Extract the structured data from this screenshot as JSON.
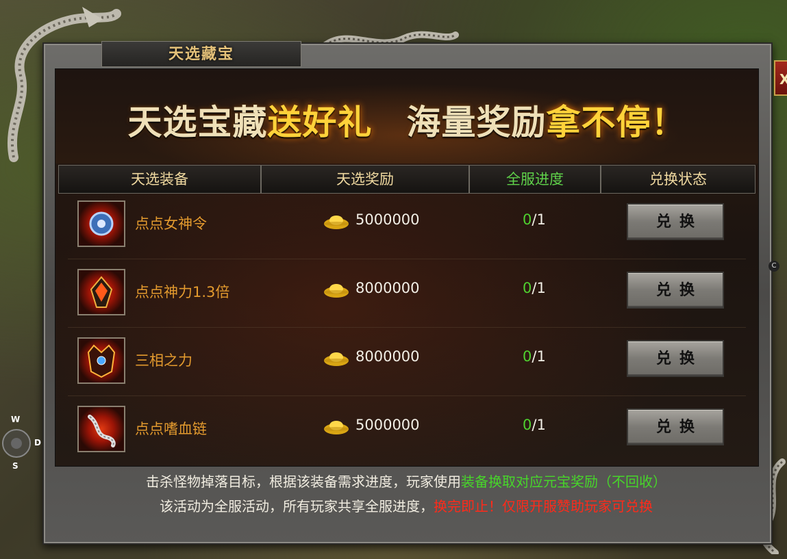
{
  "window": {
    "title": "天选藏宝",
    "close_label": "X"
  },
  "banner": {
    "part1_white": "天选宝藏",
    "part1_gold": "送好礼",
    "part2_white": "海量奖励",
    "part2_gold": "拿不停",
    "exclaim": "！"
  },
  "table": {
    "headers": [
      "天选装备",
      "天选奖励",
      "全服进度",
      "兑换状态"
    ],
    "rows": [
      {
        "name": "点点女神令",
        "icon": "goddess-token-icon",
        "reward": "5000000",
        "progress_current": "0",
        "progress_total": "/1",
        "button": "兑换"
      },
      {
        "name": "点点神力1.3倍",
        "icon": "divine-power-icon",
        "reward": "8000000",
        "progress_current": "0",
        "progress_total": "/1",
        "button": "兑换"
      },
      {
        "name": "三相之力",
        "icon": "trinity-force-icon",
        "reward": "8000000",
        "progress_current": "0",
        "progress_total": "/1",
        "button": "兑换"
      },
      {
        "name": "点点嗜血链",
        "icon": "bloodthirst-chain-icon",
        "reward": "5000000",
        "progress_current": "0",
        "progress_total": "/1",
        "button": "兑换"
      }
    ]
  },
  "footer": {
    "line1_white": "击杀怪物掉落目标，根据该装备需求进度，玩家使用",
    "line1_green": "装备换取对应元宝奖励（不回收）",
    "line2_white": "该活动为全服活动，所有玩家共享全服进度，",
    "line2_red": "换完即止！仅限开服赞助玩家可兑换"
  },
  "compass": {
    "w": "W",
    "d": "D",
    "s": "S"
  },
  "side_tag": "C",
  "colors": {
    "gold": "#ffd23a",
    "green": "#47d62a",
    "red": "#ff2a1a",
    "item_orange": "#e39a2e"
  }
}
